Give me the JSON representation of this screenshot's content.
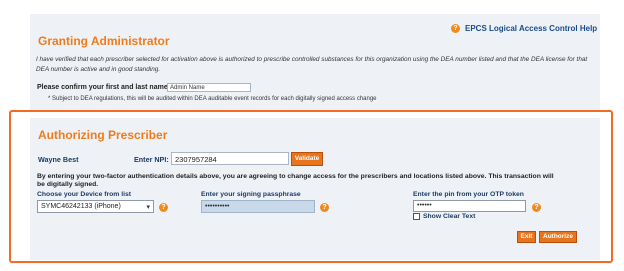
{
  "help": {
    "link_label": "EPCS Logical Access Control Help"
  },
  "granting": {
    "title": "Granting Administrator",
    "statement": "I have verified that each prescriber selected for activation above is authorized to prescribe controlled substances for this organization using the DEA number listed and that the DEA license for that DEA number is active and in good standing.",
    "confirm_label": "Please confirm your first and last name:",
    "name_value": "Admin Name",
    "dea_note": "* Subject to DEA regulations, this will be audited within DEA auditable event records for each digitally signed access change"
  },
  "authorizing": {
    "title": "Authorizing Prescriber",
    "prescriber_name": "Wayne Best",
    "npi_label": "Enter NPI:",
    "npi_value": "2307957284",
    "validate_label": "Validate",
    "agree_text": "By entering your two-factor authentication details above, you are agreeing to change access for the prescribers and locations listed above. This transaction will be digitally signed.",
    "device_label": "Choose your Device from list",
    "device_selected": "SYMC46242133 (iPhone)",
    "passphrase_label": "Enter your signing passphrase",
    "passphrase_value": "••••••••••",
    "pin_label": "Enter the pin from your OTP token",
    "pin_value": "••••••",
    "show_clear_text_label": "Show Clear Text",
    "exit_label": "Exit",
    "authorize_label": "Authorize"
  },
  "colors": {
    "accent": "#f07b1c",
    "border": "#f26b21",
    "panel": "#eef2f7",
    "label": "#1b3b66"
  }
}
